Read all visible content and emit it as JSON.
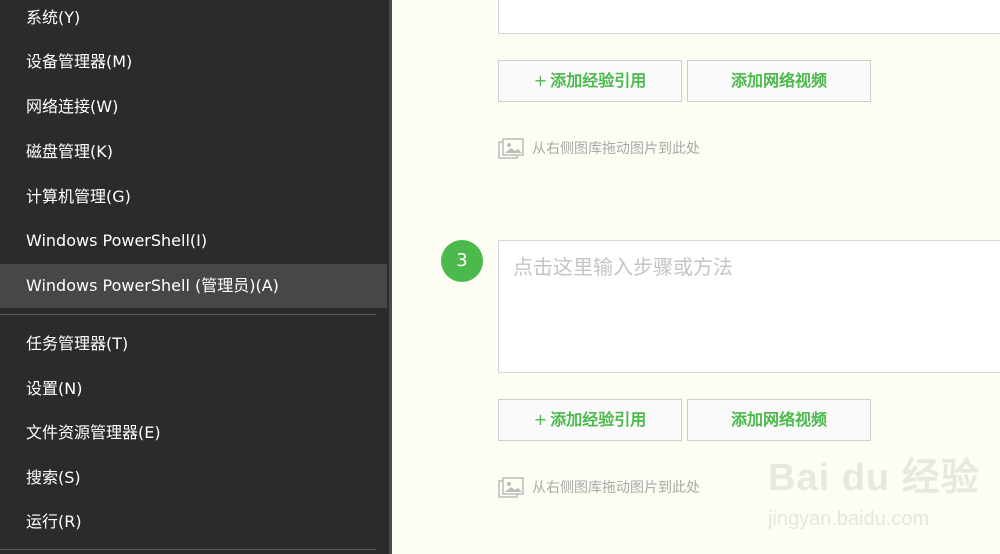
{
  "context_menu": {
    "items": [
      {
        "label": "系统(Y)"
      },
      {
        "label": "设备管理器(M)"
      },
      {
        "label": "网络连接(W)"
      },
      {
        "label": "磁盘管理(K)"
      },
      {
        "label": "计算机管理(G)"
      },
      {
        "label": "Windows PowerShell(I)"
      },
      {
        "label": "Windows PowerShell (管理员)(A)"
      },
      {
        "label": "任务管理器(T)"
      },
      {
        "label": "设置(N)"
      },
      {
        "label": "文件资源管理器(E)"
      },
      {
        "label": "搜索(S)"
      },
      {
        "label": "运行(R)"
      }
    ]
  },
  "editor": {
    "add_reference_label": "添加经验引用",
    "add_video_label": "添加网络视频",
    "add_reference_plus": "+",
    "drag_hint": "从右侧图库拖动图片到此处",
    "step_number": "3",
    "step_placeholder": "点击这里输入步骤或方法",
    "accent_color": "#4cb94c"
  },
  "watermark": {
    "brand": "Bai du 经验",
    "url": "jingyan.baidu.com"
  }
}
